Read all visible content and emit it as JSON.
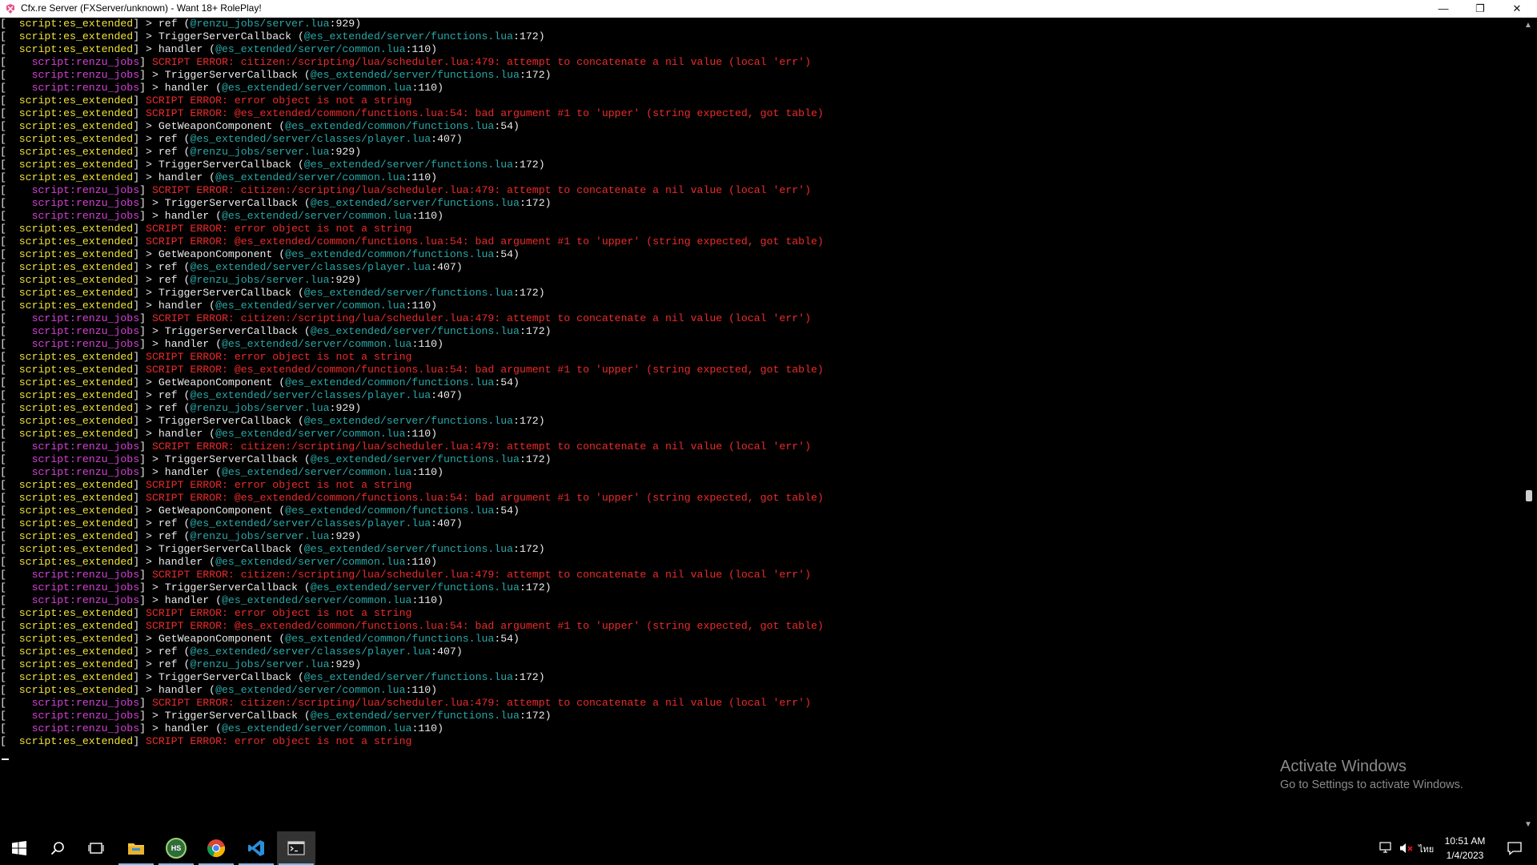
{
  "window": {
    "title": "Cfx.re Server (FXServer/unknown) - Want 18+ RolePlay!",
    "controls": {
      "minimize": "—",
      "restore": "❐",
      "close": "✕"
    }
  },
  "console": {
    "colors": {
      "yellow": "#f0e23a",
      "magenta": "#d740d6",
      "white": "#eaeaea",
      "red": "#ee2a2a",
      "cyan": "#2aa7a7"
    },
    "lines": [
      [
        "[  ",
        "script:es_extended",
        "] ",
        "> ref ",
        "(",
        "@renzu_jobs/server.lua",
        ":929)"
      ],
      [
        "[  ",
        "script:es_extended",
        "] ",
        "> TriggerServerCallback ",
        "(",
        "@es_extended/server/functions.lua",
        ":172)"
      ],
      [
        "[  ",
        "script:es_extended",
        "] ",
        "> handler ",
        "(",
        "@es_extended/server/common.lua",
        ":110)"
      ],
      [
        "[    ",
        "script:renzu_jobs",
        "] ",
        "SCRIPT ERROR: citizen:/scripting/lua/scheduler.lua:479: attempt to concatenate a nil value (local 'err')",
        "",
        "",
        ""
      ],
      [
        "[    ",
        "script:renzu_jobs",
        "] ",
        "> TriggerServerCallback ",
        "(",
        "@es_extended/server/functions.lua",
        ":172)"
      ],
      [
        "[    ",
        "script:renzu_jobs",
        "] ",
        "> handler ",
        "(",
        "@es_extended/server/common.lua",
        ":110)"
      ],
      [
        "[  ",
        "script:es_extended",
        "] ",
        "SCRIPT ERROR: error object is not a string",
        "",
        "",
        ""
      ],
      [
        "[  ",
        "script:es_extended",
        "] ",
        "SCRIPT ERROR: @es_extended/common/functions.lua:54: bad argument #1 to 'upper' (string expected, got table)",
        "",
        "",
        ""
      ],
      [
        "[  ",
        "script:es_extended",
        "] ",
        "> GetWeaponComponent ",
        "(",
        "@es_extended/common/functions.lua",
        ":54)"
      ],
      [
        "[  ",
        "script:es_extended",
        "] ",
        "> ref ",
        "(",
        "@es_extended/server/classes/player.lua",
        ":407)"
      ],
      [
        "[  ",
        "script:es_extended",
        "] ",
        "> ref ",
        "(",
        "@renzu_jobs/server.lua",
        ":929)"
      ],
      [
        "[  ",
        "script:es_extended",
        "] ",
        "> TriggerServerCallback ",
        "(",
        "@es_extended/server/functions.lua",
        ":172)"
      ],
      [
        "[  ",
        "script:es_extended",
        "] ",
        "> handler ",
        "(",
        "@es_extended/server/common.lua",
        ":110)"
      ],
      [
        "[    ",
        "script:renzu_jobs",
        "] ",
        "SCRIPT ERROR: citizen:/scripting/lua/scheduler.lua:479: attempt to concatenate a nil value (local 'err')",
        "",
        "",
        ""
      ],
      [
        "[    ",
        "script:renzu_jobs",
        "] ",
        "> TriggerServerCallback ",
        "(",
        "@es_extended/server/functions.lua",
        ":172)"
      ],
      [
        "[    ",
        "script:renzu_jobs",
        "] ",
        "> handler ",
        "(",
        "@es_extended/server/common.lua",
        ":110)"
      ],
      [
        "[  ",
        "script:es_extended",
        "] ",
        "SCRIPT ERROR: error object is not a string",
        "",
        "",
        ""
      ],
      [
        "[  ",
        "script:es_extended",
        "] ",
        "SCRIPT ERROR: @es_extended/common/functions.lua:54: bad argument #1 to 'upper' (string expected, got table)",
        "",
        "",
        ""
      ],
      [
        "[  ",
        "script:es_extended",
        "] ",
        "> GetWeaponComponent ",
        "(",
        "@es_extended/common/functions.lua",
        ":54)"
      ],
      [
        "[  ",
        "script:es_extended",
        "] ",
        "> ref ",
        "(",
        "@es_extended/server/classes/player.lua",
        ":407)"
      ],
      [
        "[  ",
        "script:es_extended",
        "] ",
        "> ref ",
        "(",
        "@renzu_jobs/server.lua",
        ":929)"
      ],
      [
        "[  ",
        "script:es_extended",
        "] ",
        "> TriggerServerCallback ",
        "(",
        "@es_extended/server/functions.lua",
        ":172)"
      ],
      [
        "[  ",
        "script:es_extended",
        "] ",
        "> handler ",
        "(",
        "@es_extended/server/common.lua",
        ":110)"
      ],
      [
        "[    ",
        "script:renzu_jobs",
        "] ",
        "SCRIPT ERROR: citizen:/scripting/lua/scheduler.lua:479: attempt to concatenate a nil value (local 'err')",
        "",
        "",
        ""
      ],
      [
        "[    ",
        "script:renzu_jobs",
        "] ",
        "> TriggerServerCallback ",
        "(",
        "@es_extended/server/functions.lua",
        ":172)"
      ],
      [
        "[    ",
        "script:renzu_jobs",
        "] ",
        "> handler ",
        "(",
        "@es_extended/server/common.lua",
        ":110)"
      ],
      [
        "[  ",
        "script:es_extended",
        "] ",
        "SCRIPT ERROR: error object is not a string",
        "",
        "",
        ""
      ],
      [
        "[  ",
        "script:es_extended",
        "] ",
        "SCRIPT ERROR: @es_extended/common/functions.lua:54: bad argument #1 to 'upper' (string expected, got table)",
        "",
        "",
        ""
      ],
      [
        "[  ",
        "script:es_extended",
        "] ",
        "> GetWeaponComponent ",
        "(",
        "@es_extended/common/functions.lua",
        ":54)"
      ],
      [
        "[  ",
        "script:es_extended",
        "] ",
        "> ref ",
        "(",
        "@es_extended/server/classes/player.lua",
        ":407)"
      ],
      [
        "[  ",
        "script:es_extended",
        "] ",
        "> ref ",
        "(",
        "@renzu_jobs/server.lua",
        ":929)"
      ],
      [
        "[  ",
        "script:es_extended",
        "] ",
        "> TriggerServerCallback ",
        "(",
        "@es_extended/server/functions.lua",
        ":172)"
      ],
      [
        "[  ",
        "script:es_extended",
        "] ",
        "> handler ",
        "(",
        "@es_extended/server/common.lua",
        ":110)"
      ],
      [
        "[    ",
        "script:renzu_jobs",
        "] ",
        "SCRIPT ERROR: citizen:/scripting/lua/scheduler.lua:479: attempt to concatenate a nil value (local 'err')",
        "",
        "",
        ""
      ],
      [
        "[    ",
        "script:renzu_jobs",
        "] ",
        "> TriggerServerCallback ",
        "(",
        "@es_extended/server/functions.lua",
        ":172)"
      ],
      [
        "[    ",
        "script:renzu_jobs",
        "] ",
        "> handler ",
        "(",
        "@es_extended/server/common.lua",
        ":110)"
      ],
      [
        "[  ",
        "script:es_extended",
        "] ",
        "SCRIPT ERROR: error object is not a string",
        "",
        "",
        ""
      ],
      [
        "[  ",
        "script:es_extended",
        "] ",
        "SCRIPT ERROR: @es_extended/common/functions.lua:54: bad argument #1 to 'upper' (string expected, got table)",
        "",
        "",
        ""
      ],
      [
        "[  ",
        "script:es_extended",
        "] ",
        "> GetWeaponComponent ",
        "(",
        "@es_extended/common/functions.lua",
        ":54)"
      ],
      [
        "[  ",
        "script:es_extended",
        "] ",
        "> ref ",
        "(",
        "@es_extended/server/classes/player.lua",
        ":407)"
      ],
      [
        "[  ",
        "script:es_extended",
        "] ",
        "> ref ",
        "(",
        "@renzu_jobs/server.lua",
        ":929)"
      ],
      [
        "[  ",
        "script:es_extended",
        "] ",
        "> TriggerServerCallback ",
        "(",
        "@es_extended/server/functions.lua",
        ":172)"
      ],
      [
        "[  ",
        "script:es_extended",
        "] ",
        "> handler ",
        "(",
        "@es_extended/server/common.lua",
        ":110)"
      ],
      [
        "[    ",
        "script:renzu_jobs",
        "] ",
        "SCRIPT ERROR: citizen:/scripting/lua/scheduler.lua:479: attempt to concatenate a nil value (local 'err')",
        "",
        "",
        ""
      ],
      [
        "[    ",
        "script:renzu_jobs",
        "] ",
        "> TriggerServerCallback ",
        "(",
        "@es_extended/server/functions.lua",
        ":172)"
      ],
      [
        "[    ",
        "script:renzu_jobs",
        "] ",
        "> handler ",
        "(",
        "@es_extended/server/common.lua",
        ":110)"
      ],
      [
        "[  ",
        "script:es_extended",
        "] ",
        "SCRIPT ERROR: error object is not a string",
        "",
        "",
        ""
      ],
      [
        "[  ",
        "script:es_extended",
        "] ",
        "SCRIPT ERROR: @es_extended/common/functions.lua:54: bad argument #1 to 'upper' (string expected, got table)",
        "",
        "",
        ""
      ],
      [
        "[  ",
        "script:es_extended",
        "] ",
        "> GetWeaponComponent ",
        "(",
        "@es_extended/common/functions.lua",
        ":54)"
      ],
      [
        "[  ",
        "script:es_extended",
        "] ",
        "> ref ",
        "(",
        "@es_extended/server/classes/player.lua",
        ":407)"
      ],
      [
        "[  ",
        "script:es_extended",
        "] ",
        "> ref ",
        "(",
        "@renzu_jobs/server.lua",
        ":929)"
      ],
      [
        "[  ",
        "script:es_extended",
        "] ",
        "> TriggerServerCallback ",
        "(",
        "@es_extended/server/functions.lua",
        ":172)"
      ],
      [
        "[  ",
        "script:es_extended",
        "] ",
        "> handler ",
        "(",
        "@es_extended/server/common.lua",
        ":110)"
      ],
      [
        "[    ",
        "script:renzu_jobs",
        "] ",
        "SCRIPT ERROR: citizen:/scripting/lua/scheduler.lua:479: attempt to concatenate a nil value (local 'err')",
        "",
        "",
        ""
      ],
      [
        "[    ",
        "script:renzu_jobs",
        "] ",
        "> TriggerServerCallback ",
        "(",
        "@es_extended/server/functions.lua",
        ":172)"
      ],
      [
        "[    ",
        "script:renzu_jobs",
        "] ",
        "> handler ",
        "(",
        "@es_extended/server/common.lua",
        ":110)"
      ],
      [
        "[  ",
        "script:es_extended",
        "] ",
        "SCRIPT ERROR: error object is not a string",
        "",
        "",
        ""
      ]
    ]
  },
  "watermark": {
    "title": "Activate Windows",
    "subtitle": "Go to Settings to activate Windows."
  },
  "taskbar": {
    "apps": [
      "start-icon",
      "search-icon",
      "task-view-icon",
      "file-explorer-icon",
      "hs-app-icon",
      "chrome-icon",
      "vscode-icon",
      "terminal-icon"
    ],
    "hs_label": "HS",
    "language": "ไทย",
    "time": "10:51 AM",
    "date": "1/4/2023"
  }
}
